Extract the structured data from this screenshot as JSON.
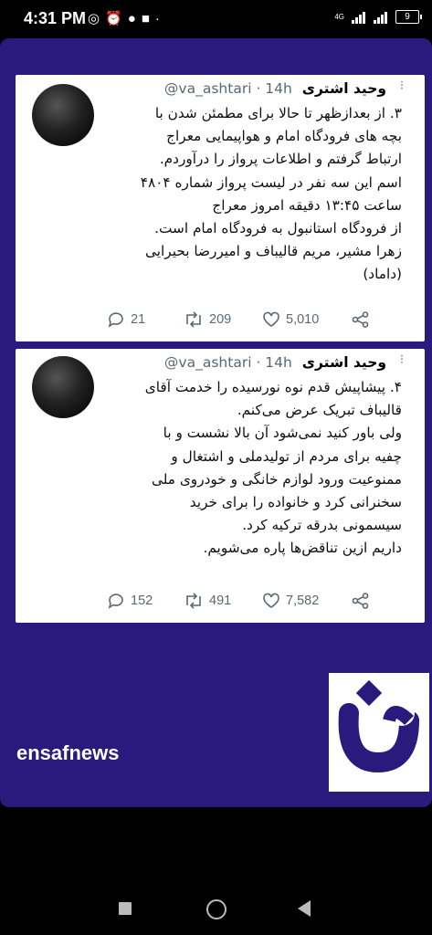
{
  "status_bar": {
    "time": "4:31 PM",
    "left_icons": [
      "whatsapp-icon",
      "alarm-icon",
      "location-icon",
      "app-icon",
      "dot-icon"
    ],
    "network": "4G",
    "battery": "9"
  },
  "tweets": [
    {
      "name": "وحید اشتری",
      "handle": "@va_ashtari",
      "time": "· 14h",
      "lines": [
        "۳. از بعدازظهر تا حالا برای مطمئن شدن با",
        "بچه های فرودگاه امام و هواپیمایی معراج",
        "ارتباط گرفتم و اطلاعات پرواز را درآوردم.",
        "اسم این سه نفر در لیست پرواز شماره ۴۸۰۴",
        "ساعت ۱۳:۴۵ دقیقه امروز معراج",
        "از فرودگاه استانبول به فرودگاه امام است.",
        "زهرا مشیر، مریم قالیباف و امیررضا بحیرایی",
        "(داماد)"
      ],
      "replies": "21",
      "retweets": "209",
      "likes": "5,010"
    },
    {
      "name": "وحید اشتری",
      "handle": "@va_ashtari",
      "time": "· 14h",
      "lines": [
        "۴. پیشاپیش قدم نوه نورسیده را خدمت آقای",
        "قالیباف تبریک عرض می‌کنم.",
        "ولی باور کنید نمی‌شود آن بالا نشست و با",
        "چفیه برای مردم از تولیدملی و اشتغال و",
        "ممنوعیت ورود لوازم خانگی و خودروی ملی",
        "سخنرانی کرد و خانواده را برای خرید",
        "سیسمونی بدرقه ترکیه کرد.",
        "داریم ازین تناقض‌ها پاره می‌شویم."
      ],
      "replies": "152",
      "retweets": "491",
      "likes": "7,582"
    }
  ],
  "branding": {
    "text": "ensafnews",
    "logo": "ف"
  },
  "colors": {
    "frame": "#2a1a7e",
    "card": "#ffffff",
    "meta": "#5a6873"
  }
}
